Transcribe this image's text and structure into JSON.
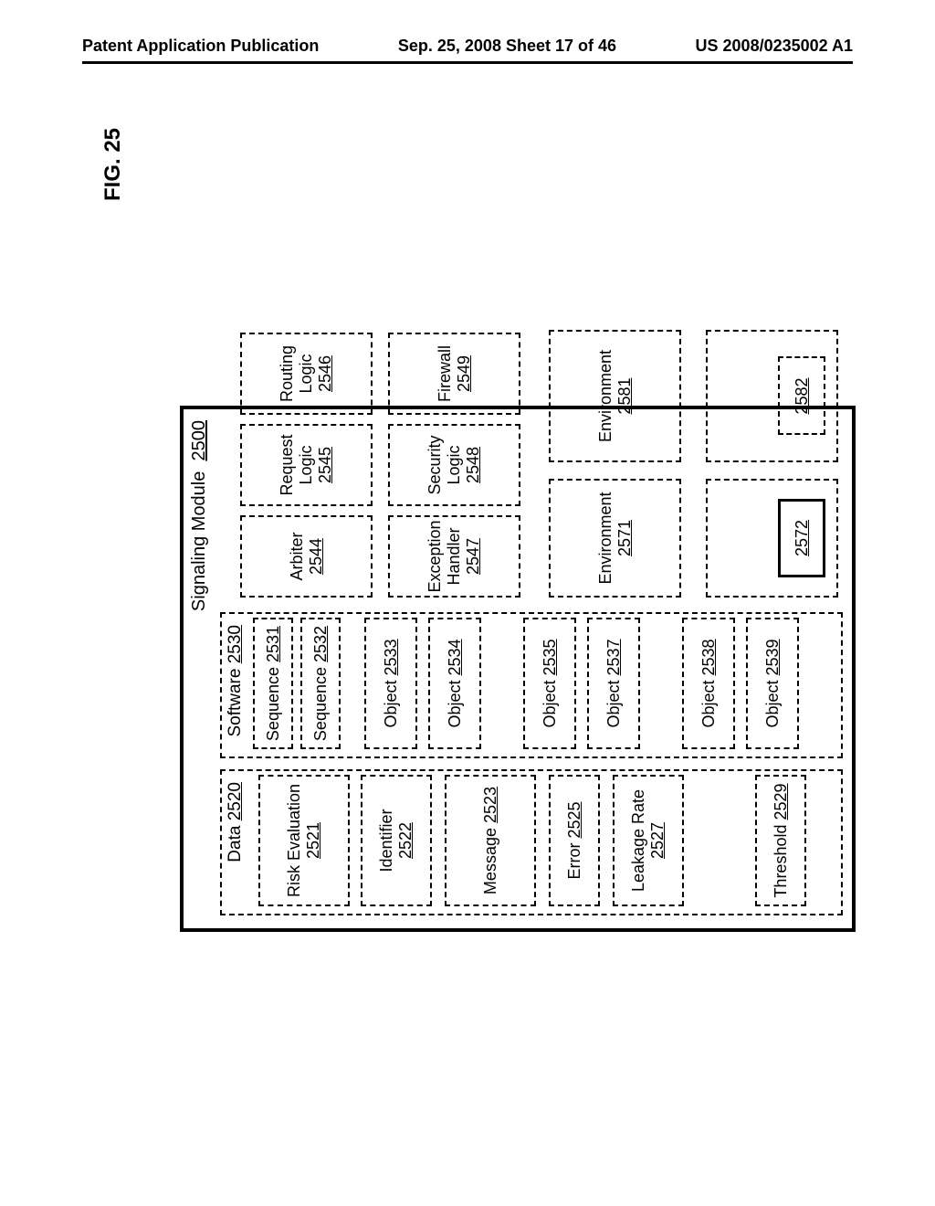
{
  "header": {
    "left": "Patent Application Publication",
    "center": "Sep. 25, 2008  Sheet 17 of 46",
    "right": "US 2008/0235002 A1"
  },
  "figure_label": "FIG. 25",
  "signaling_module": {
    "label": "Signaling Module",
    "ref": "2500"
  },
  "data_col": {
    "label": "Data",
    "ref": "2520",
    "risk": {
      "label": "Risk Evaluation",
      "ref": "2521"
    },
    "identifier": {
      "label": "Identifier",
      "ref": "2522"
    },
    "message": {
      "label": "Message",
      "ref": "2523"
    },
    "error": {
      "label": "Error",
      "ref": "2525"
    },
    "leakage": {
      "label": "Leakage Rate",
      "ref": "2527"
    },
    "threshold": {
      "label": "Threshold",
      "ref": "2529"
    }
  },
  "soft_col": {
    "label": "Software",
    "ref": "2530",
    "seq1": {
      "label": "Sequence",
      "ref": "2531"
    },
    "seq2": {
      "label": "Sequence",
      "ref": "2532"
    },
    "obj3": {
      "label": "Object",
      "ref": "2533"
    },
    "obj4": {
      "label": "Object",
      "ref": "2534"
    },
    "obj5": {
      "label": "Object",
      "ref": "2535"
    },
    "obj7": {
      "label": "Object",
      "ref": "2537"
    },
    "obj8": {
      "label": "Object",
      "ref": "2538"
    },
    "obj9": {
      "label": "Object",
      "ref": "2539"
    }
  },
  "right_blocks": {
    "arbiter": {
      "label": "Arbiter",
      "ref": "2544"
    },
    "request": {
      "label": "Request Logic",
      "ref": "2545"
    },
    "routing": {
      "label": "Routing Logic",
      "ref": "2546"
    },
    "exception": {
      "label": "Exception Handler",
      "ref": "2547"
    },
    "security": {
      "label": "Security Logic",
      "ref": "2548"
    },
    "firewall": {
      "label": "Firewall",
      "ref": "2549"
    },
    "env1": {
      "label": "Environment",
      "ref": "2571"
    },
    "env2": {
      "label": "Environment",
      "ref": "2581"
    },
    "box2572": {
      "ref": "2572"
    },
    "box2582": {
      "ref": "2582"
    }
  }
}
